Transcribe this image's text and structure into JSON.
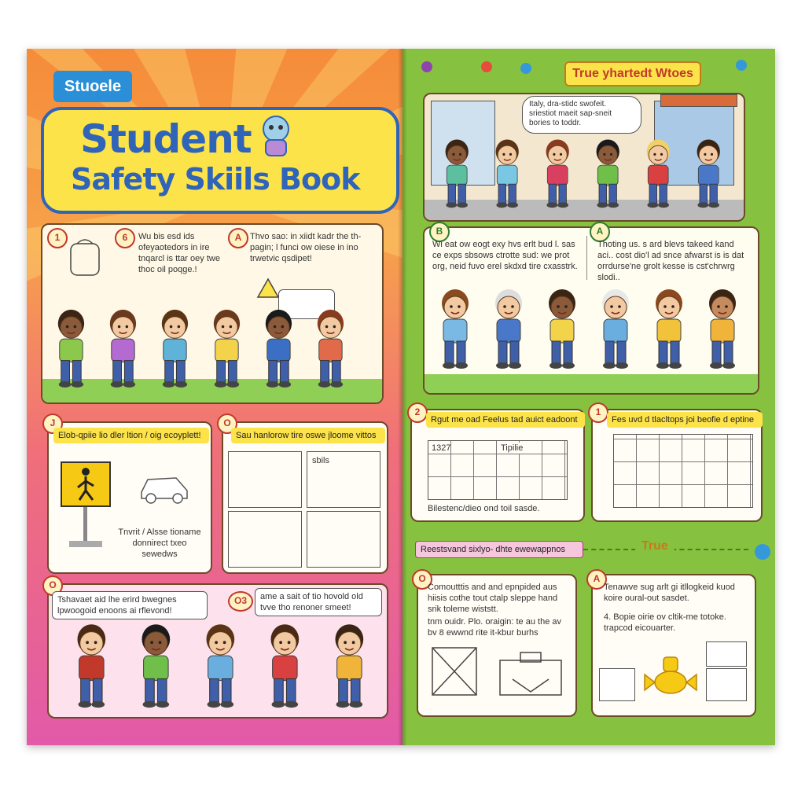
{
  "left_page": {
    "tab_label": "Stuoele",
    "title_line1": "Student",
    "title_line2": "Safety Skiils Book",
    "panel1": {
      "badges": [
        "1",
        "6",
        "A"
      ],
      "text_a": "Wu bis esd ids ofeyaotedors in ire tnqarcl is ttar oey twe thoc oil poqge.!",
      "text_b": "Thvo sao: in xiidt kadr the th-pagin; l funci ow oiese in ino trwetvic qsdipet!"
    },
    "panel2": {
      "badge": "J",
      "header": "Elob-qpiie lio dler ltion / oig ecoyplett!",
      "caption": "Tnvrit / Alsse tioname donnirect txeo sewedws"
    },
    "panel3": {
      "badge": "O",
      "header": "Sau hanlorow tire oswe jloome vittos",
      "grid_label": "sbils"
    },
    "panel4": {
      "badge": "O",
      "text": "Tshavaet aid lhe erird bwegnes lpwoogoid enoons ai rflevond!"
    },
    "panel5": {
      "badge": "O3",
      "text": "ame a sait of tio hovold old tvve tho renoner smeet!"
    }
  },
  "right_page": {
    "banner": "True yhartedt Wtoes",
    "speech_bubble": "Italy, dra-stidc swofeit. sriestiot maeit sap-sneit bories to toddr.",
    "panel1": {
      "badge": "B",
      "text": "Wi eat ow eogt exy hvs erlt bud l. sas ce exps sbsows ctrotte sud: we prot org, neid fuvo erel skdxd tire cxasstrk."
    },
    "panel2": {
      "badge": "A",
      "text": "Thoting us. s ard blevs takeed kand aci.. cost dio'l ad snce afwarst is is dat orrdurse'ne grolt kesse is cst'chrwrg slodi.."
    },
    "panel3": {
      "badge": "2",
      "header": "Rgut me oad Feelus tad auict eadoont",
      "grid_label": "1327",
      "grid_label2": "Tipilie",
      "caption": "Bilestenc/dieo ond toil sasde."
    },
    "panel4": {
      "badge": "1",
      "header": "Fes uvd d tlacltops joi beofie d eptine"
    },
    "section_header": "Reestsvand sixlyo- dhte ewewappnos",
    "section_true": "True",
    "panel5": {
      "badge": "O",
      "text1": "Comoutttis and and epnpided aus hiisis cothe tout ctalp sleppe hand srik toleme wiststt.",
      "text2": "tnm ouidr. Plo. oraigin: te au the av bv 8 ewwnd rite it-kbur burhs"
    },
    "panel6": {
      "badge": "A",
      "text1": "Tenawve sug arlt gi itllogkeid kuod koire oural-out sasdet.",
      "text2": "4. Bopie oirie ov cltik-me totoke. trapcod eicouarter."
    }
  },
  "colors": {
    "left_top": "#f58c3a",
    "left_bottom": "#e25aa8",
    "right_bg": "#86c23f",
    "title_yellow": "#fde34a",
    "title_blue": "#2f64b8",
    "tab_blue": "#2a8fd6"
  }
}
